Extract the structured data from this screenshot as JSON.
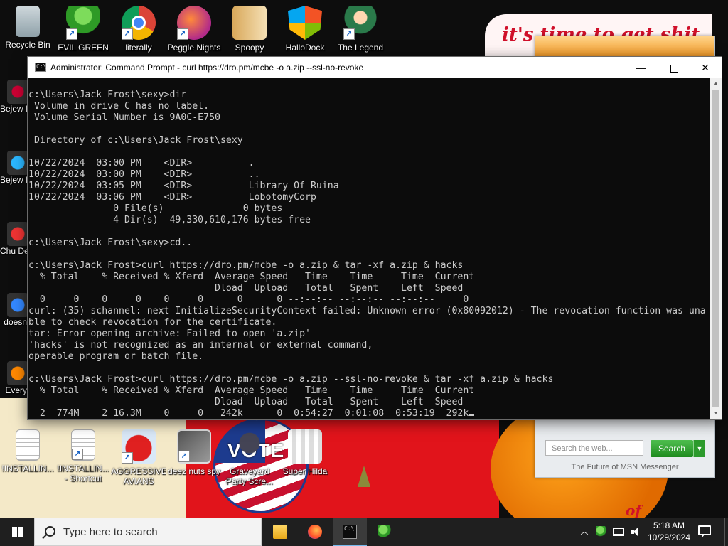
{
  "desktop": {
    "top_icons": [
      {
        "label": "Recycle Bin",
        "icon": "recycle-bin-icon"
      },
      {
        "label": "EVIL GREEN MSN CO...",
        "icon": "msn-icon"
      },
      {
        "label": "literally",
        "icon": "chrome-icon"
      },
      {
        "label": "Peggle Nights",
        "icon": "peggle-icon"
      },
      {
        "label": "Spoopy",
        "icon": "spoopy-icon"
      },
      {
        "label": "HalloDock",
        "icon": "hallodock-icon"
      },
      {
        "label": "The Legend",
        "icon": "legend-icon"
      }
    ],
    "side_icons": [
      {
        "label": "Bejew Del"
      },
      {
        "label": "Bejew Del"
      },
      {
        "label": "Chu Del"
      },
      {
        "label": "doesn"
      },
      {
        "label": "Every"
      }
    ],
    "bottom_icons": [
      {
        "label": "!INSTALLIN...",
        "icon": "document-icon"
      },
      {
        "label": "!INSTALLIN... - Shortcut",
        "icon": "document-shortcut-icon"
      },
      {
        "label": "AGGRESSIVE AVIANS",
        "icon": "angry-bird-icon"
      },
      {
        "label": "deez nuts spy",
        "icon": "deez-icon"
      },
      {
        "label": "Graveyard Party Scre...",
        "icon": "graveyard-icon"
      },
      {
        "label": "Super Hilda",
        "icon": "hilda-icon"
      }
    ],
    "wallpaper": {
      "banner_text": "it's time to get shit",
      "vote_text": "VOTE",
      "bottom_text": "of"
    }
  },
  "msn_widget": {
    "search_placeholder": "Search the web...",
    "search_button": "Search",
    "footer": "The Future of MSN Messenger"
  },
  "window": {
    "title": "Administrator: Command Prompt - curl  https://dro.pm/mcbe -o a.zip --ssl-no-revoke",
    "minimize_glyph": "—",
    "close_glyph": "✕",
    "console_lines": [
      "",
      "c:\\Users\\Jack Frost\\sexy>dir",
      " Volume in drive C has no label.",
      " Volume Serial Number is 9A0C-E750",
      "",
      " Directory of c:\\Users\\Jack Frost\\sexy",
      "",
      "10/22/2024  03:00 PM    <DIR>          .",
      "10/22/2024  03:00 PM    <DIR>          ..",
      "10/22/2024  03:05 PM    <DIR>          Library Of Ruina",
      "10/22/2024  03:06 PM    <DIR>          LobotomyCorp",
      "               0 File(s)              0 bytes",
      "               4 Dir(s)  49,330,610,176 bytes free",
      "",
      "c:\\Users\\Jack Frost\\sexy>cd..",
      "",
      "c:\\Users\\Jack Frost>curl https://dro.pm/mcbe -o a.zip & tar -xf a.zip & hacks",
      "  % Total    % Received % Xferd  Average Speed   Time    Time     Time  Current",
      "                                 Dload  Upload   Total   Spent    Left  Speed",
      "  0     0    0     0    0     0      0      0 --:--:-- --:--:-- --:--:--     0",
      "curl: (35) schannel: next InitializeSecurityContext failed: Unknown error (0x80092012) - The revocation function was una",
      "ble to check revocation for the certificate.",
      "tar: Error opening archive: Failed to open 'a.zip'",
      "'hacks' is not recognized as an internal or external command,",
      "operable program or batch file.",
      "",
      "c:\\Users\\Jack Frost>curl https://dro.pm/mcbe -o a.zip --ssl-no-revoke & tar -xf a.zip & hacks",
      "  % Total    % Received % Xferd  Average Speed   Time    Time     Time  Current",
      "                                 Dload  Upload   Total   Spent    Left  Speed",
      "  2  774M    2 16.3M    0     0   242k      0  0:54:27  0:01:08  0:53:19  292k"
    ]
  },
  "taskbar": {
    "search_placeholder": "Type here to search",
    "apps": [
      {
        "name": "file-explorer",
        "icon": "folder-icon"
      },
      {
        "name": "firefox",
        "icon": "firefox-icon"
      },
      {
        "name": "command-prompt",
        "icon": "cmd-icon",
        "active": true
      },
      {
        "name": "msn",
        "icon": "msn-icon"
      }
    ],
    "tray_up_glyph": "︿",
    "clock": {
      "time": "5:18 AM",
      "date": "10/29/2024"
    }
  }
}
